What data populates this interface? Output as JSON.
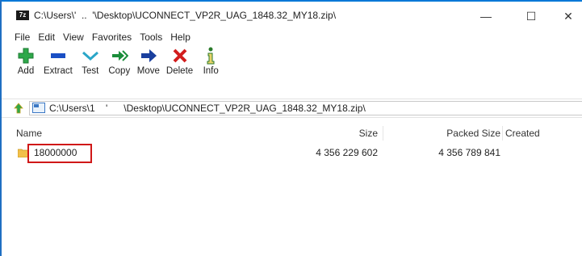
{
  "window": {
    "title": "C:\\Users\\'  ..  '\\Desktop\\UCONNECT_VP2R_UAG_1848.32_MY18.zip\\",
    "controls": {
      "minimize": "—",
      "maximize": "☐",
      "close": "✕"
    }
  },
  "menu": [
    "File",
    "Edit",
    "View",
    "Favorites",
    "Tools",
    "Help"
  ],
  "toolbar": [
    {
      "label": "Add",
      "icon": "plus-icon",
      "color": "#2ea84a"
    },
    {
      "label": "Extract",
      "icon": "minus-icon",
      "color": "#1a4fc4"
    },
    {
      "label": "Test",
      "icon": "check-icon",
      "color": "#2aa6c8"
    },
    {
      "label": "Copy",
      "icon": "double-arrow-icon",
      "color": "#1b8d3a"
    },
    {
      "label": "Move",
      "icon": "arrow-right-icon",
      "color": "#1a3f9e"
    },
    {
      "label": "Delete",
      "icon": "x-icon",
      "color": "#d21d1d"
    },
    {
      "label": "Info",
      "icon": "info-icon",
      "color": "#2a7a2a"
    }
  ],
  "address": {
    "path": "C:\\Users\\1    '      \\Desktop\\UCONNECT_VP2R_UAG_1848.32_MY18.zip\\"
  },
  "columns": {
    "name": "Name",
    "size": "Size",
    "packed_size": "Packed Size",
    "created": "Created"
  },
  "rows": [
    {
      "name": "18000000",
      "size": "4 356 229 602",
      "packed_size": "4 356 789 841",
      "created": ""
    }
  ],
  "colors": {
    "highlight": "#d01818",
    "folder": "#f2c04a",
    "accent": "#0078d7"
  }
}
